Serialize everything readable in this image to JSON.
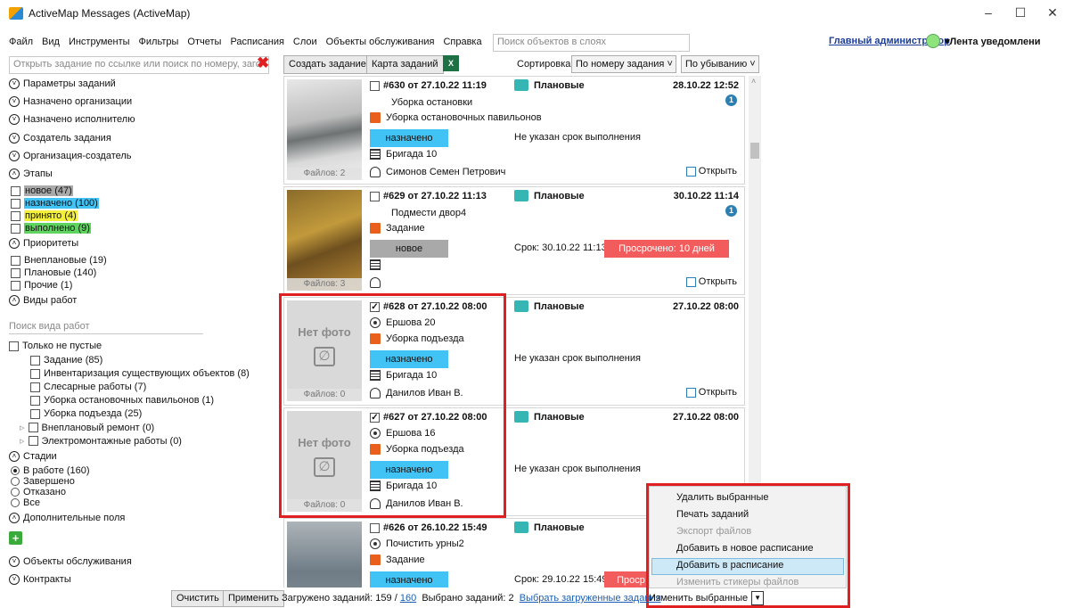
{
  "window": {
    "title": "ActiveMap Messages (ActiveMap)",
    "minimize": "–",
    "maximize": "☐",
    "close": "✕"
  },
  "menu": [
    "Файл",
    "Вид",
    "Инструменты",
    "Фильтры",
    "Отчеты",
    "Расписания",
    "Слои",
    "Объекты обслуживания",
    "Справка"
  ],
  "layer_search_placeholder": "Поиск объектов в слоях",
  "user": {
    "name": "Главный администратор",
    "notifications": "▾Лента уведомлени"
  },
  "toolbar": {
    "open_task_placeholder": "Открыть задание по ссылке или поиск по номеру, загол",
    "create_task": "Создать задание",
    "task_map": "Карта заданий",
    "excel": "X",
    "sort_label": "Сортировка",
    "sort_by": "По номеру задания",
    "sort_order": "По убыванию"
  },
  "filters": {
    "task_params": "Параметры заданий",
    "assigned_org": "Назначено организации",
    "assigned_exec": "Назначено исполнителю",
    "task_creator": "Создатель задания",
    "creator_org": "Организация-создатель",
    "stages": "Этапы",
    "stage_items": [
      {
        "label": "новое (47)",
        "color": "#a9a9a9"
      },
      {
        "label": "назначено (100)",
        "color": "#42c3f5"
      },
      {
        "label": "принято (4)",
        "color": "#f4f03a"
      },
      {
        "label": "выполнено (9)",
        "color": "#5fd35f"
      }
    ],
    "priorities": "Приоритеты",
    "priority_items": [
      "Внеплановые (19)",
      "Плановые (140)",
      "Прочие (1)"
    ],
    "work_types": "Виды работ",
    "work_search_placeholder": "Поиск вида работ",
    "only_nonempty": "Только не пустые",
    "work_items": [
      "Задание (85)",
      "Инвентаризация существующих объектов (8)",
      "Слесарные работы (7)",
      "Уборка остановочных павильонов (1)",
      "Уборка подъезда (25)",
      "Внеплановый ремонт (0)",
      "Электромонтажные работы (0)"
    ],
    "states": "Стадии",
    "state_items": [
      "В работе (160)",
      "Завершено",
      "Отказано",
      "Все"
    ],
    "extra_fields": "Дополнительные поля",
    "service_objects": "Объекты обслуживания",
    "contracts": "Контракты",
    "clear": "Очистить",
    "apply": "Применить"
  },
  "tasks": [
    {
      "num": "#630",
      "from": "от",
      "date": "27.10.22 11:19",
      "type": "Плановые",
      "due_date": "28.10.22 12:52",
      "title": "Уборка остановки",
      "work": "Уборка остановочных павильонов",
      "status": "назначено",
      "deadline": "Не указан срок выполнения",
      "brigade": "Бригада 10",
      "person": "Симонов Семен Петрович",
      "files": "Файлов: 2",
      "info": "1",
      "open": "Открыть"
    },
    {
      "num": "#629",
      "from": "от",
      "date": "27.10.22 11:13",
      "type": "Плановые",
      "due_date": "30.10.22 11:14",
      "title": "Подмести двор4",
      "work": "Задание",
      "status": "новое",
      "deadline": "Срок: 30.10.22 11:13",
      "overdue": "Просрочено: 10 дней",
      "files": "Файлов: 3",
      "info": "1",
      "open": "Открыть"
    },
    {
      "num": "#628",
      "from": "от",
      "date": "27.10.22 08:00",
      "type": "Плановые",
      "due_date": "27.10.22 08:00",
      "address": "Ершова 20",
      "work": "Уборка подъезда",
      "status": "назначено",
      "deadline": "Не указан срок выполнения",
      "brigade": "Бригада 10",
      "person": "Данилов Иван В.",
      "files": "Файлов: 0",
      "nophoto": "Нет фото",
      "open": "Открыть"
    },
    {
      "num": "#627",
      "from": "от",
      "date": "27.10.22 08:00",
      "type": "Плановые",
      "due_date": "27.10.22 08:00",
      "address": "Ершова 16",
      "work": "Уборка подъезда",
      "status": "назначено",
      "deadline": "Не указан срок выполнения",
      "brigade": "Бригада 10",
      "person": "Данилов Иван В.",
      "files": "Файлов: 0",
      "nophoto": "Нет фото"
    },
    {
      "num": "#626",
      "from": "от",
      "date": "26.10.22 15:49",
      "type": "Плановые",
      "address": "Почистить урны2",
      "work": "Задание",
      "status": "назначено",
      "deadline": "Срок: 29.10.22 15:49",
      "overdue": "Проср"
    }
  ],
  "context_menu": [
    "Удалить выбранные",
    "Печать заданий",
    "Экспорт файлов",
    "Добавить в новое расписание",
    "Добавить в расписание",
    "Изменить стикеры файлов"
  ],
  "status": {
    "loaded": "Загружено заданий: 159 /",
    "total": "160",
    "selected": "Выбрано заданий: 2",
    "select_loaded": "Выбрать загруженные задания",
    "change_selected": "Изменить выбранные"
  }
}
